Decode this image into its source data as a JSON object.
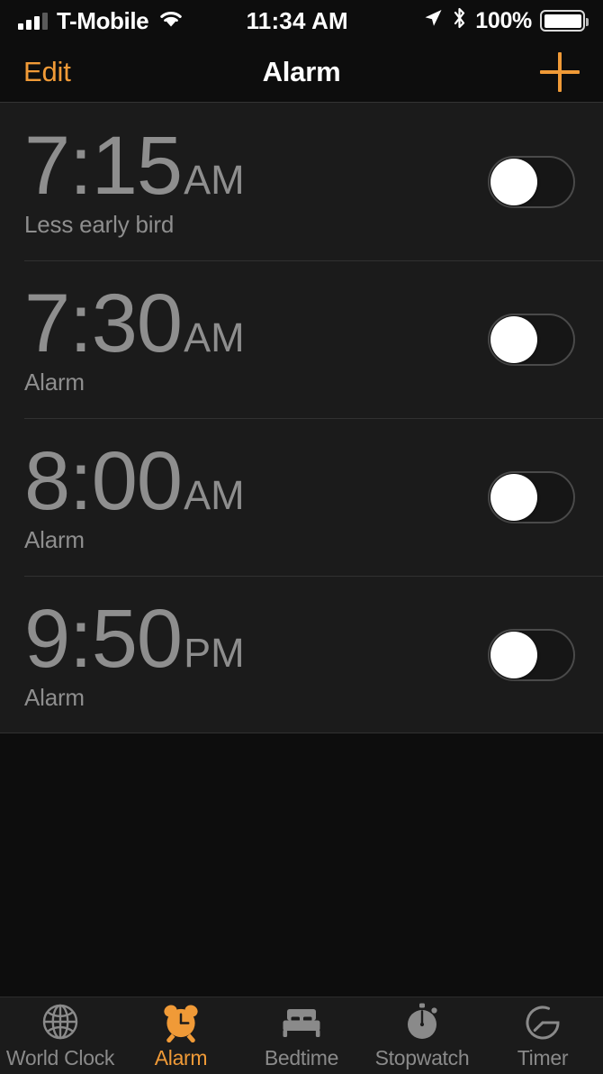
{
  "status_bar": {
    "carrier": "T-Mobile",
    "time": "11:34 AM",
    "battery_percent": "100%",
    "signal_bars_filled": 3,
    "signal_bars_total": 4,
    "icons": [
      "signal-bars-icon",
      "wifi-icon",
      "location-arrow-icon",
      "bluetooth-icon",
      "battery-icon"
    ]
  },
  "nav": {
    "edit_label": "Edit",
    "title": "Alarm",
    "add_label": "+"
  },
  "colors": {
    "accent": "#f09a37",
    "time_text": "#8e8e8e",
    "list_bg": "#1b1b1b",
    "page_bg": "#0d0d0d",
    "separator": "#313131"
  },
  "alarms": [
    {
      "hour": "7",
      "sep": ":",
      "minute": "15",
      "ampm": "AM",
      "label": "Less early bird",
      "enabled": false
    },
    {
      "hour": "7",
      "sep": ":",
      "minute": "30",
      "ampm": "AM",
      "label": "Alarm",
      "enabled": false
    },
    {
      "hour": "8",
      "sep": ":",
      "minute": "00",
      "ampm": "AM",
      "label": "Alarm",
      "enabled": false
    },
    {
      "hour": "9",
      "sep": ":",
      "minute": "50",
      "ampm": "PM",
      "label": "Alarm",
      "enabled": false
    }
  ],
  "tabs": [
    {
      "label": "World Clock",
      "icon": "globe-icon",
      "active": false
    },
    {
      "label": "Alarm",
      "icon": "alarm-clock-icon",
      "active": true
    },
    {
      "label": "Bedtime",
      "icon": "bed-icon",
      "active": false
    },
    {
      "label": "Stopwatch",
      "icon": "stopwatch-icon",
      "active": false
    },
    {
      "label": "Timer",
      "icon": "timer-icon",
      "active": false
    }
  ]
}
